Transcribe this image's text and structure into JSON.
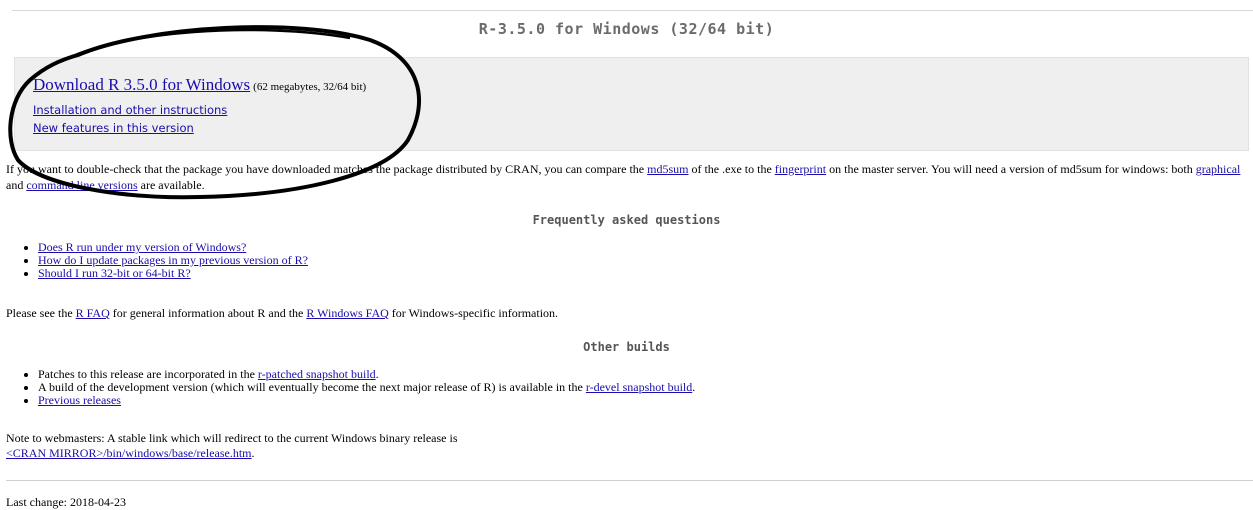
{
  "page": {
    "title": "R-3.5.0 for Windows (32/64 bit)"
  },
  "download": {
    "link_text": "Download R 3.5.0 for Windows",
    "meta": "(62 megabytes, 32/64 bit)",
    "install_link": "Installation and other instructions",
    "features_link": "New features in this version"
  },
  "check": {
    "text_1": "If you want to double-check that the package you have downloaded matches the package distributed by CRAN, you can compare the ",
    "md5sum_link": "md5sum",
    "text_2": " of the .exe to the ",
    "fingerprint_link": "fingerprint",
    "text_3": " on the master server. You will need a version of md5sum for windows: both ",
    "graphical_link": "graphical",
    "text_4": " and ",
    "cmdline_link": "command line versions",
    "text_5": " are available."
  },
  "faq": {
    "heading": "Frequently asked questions",
    "items": [
      "Does R run under my version of Windows?",
      "How do I update packages in my previous version of R?",
      "Should I run 32-bit or 64-bit R?"
    ]
  },
  "see_also": {
    "text_1": "Please see the ",
    "rfaq_link": "R FAQ",
    "text_2": " for general information about R and the ",
    "rwinfaq_link": "R Windows FAQ",
    "text_3": " for Windows-specific information."
  },
  "builds": {
    "heading": "Other builds",
    "patches_text": "Patches to this release are incorporated in the ",
    "patches_link": "r-patched snapshot build",
    "patches_end": ".",
    "devel_text": "A build of the development version (which will eventually become the next major release of R) is available in the ",
    "devel_link": "r-devel snapshot build",
    "devel_end": ".",
    "previous_link": "Previous releases"
  },
  "note": {
    "text": "Note to webmasters: A stable link which will redirect to the current Windows binary release is",
    "link": "<CRAN MIRROR>/bin/windows/base/release.htm",
    "end": "."
  },
  "footer": {
    "last_change": "Last change: 2018-04-23"
  }
}
